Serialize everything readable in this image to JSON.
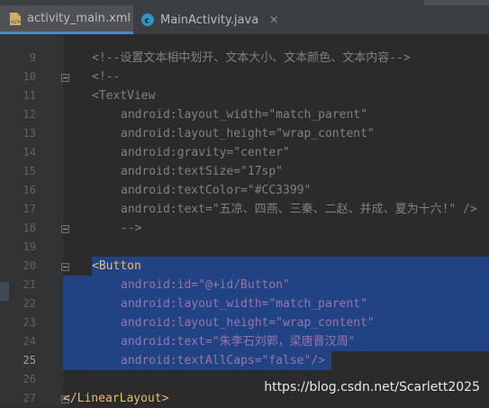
{
  "tabs": [
    {
      "label": "activity_main.xml",
      "icon": "xml-file-icon"
    },
    {
      "label": "MainActivity.java",
      "icon": "java-class-icon"
    }
  ],
  "lines": [
    {
      "num": "9",
      "text": "<!--设置文本相中划开、文本大小、文本颜色、文本内容-->"
    },
    {
      "num": "10",
      "text": "<!--"
    },
    {
      "num": "11",
      "text": "<TextView"
    },
    {
      "num": "12",
      "text": "android:layout_width=\"match_parent\""
    },
    {
      "num": "13",
      "text": "android:layout_height=\"wrap_content\""
    },
    {
      "num": "14",
      "text": "android:gravity=\"center\""
    },
    {
      "num": "15",
      "text": "android:textSize=\"17sp\""
    },
    {
      "num": "16",
      "text": "android:textColor=\"#CC3399\""
    },
    {
      "num": "17",
      "text": "android:text=\"五凉、四燕、三秦、二赵、并成、夏为十六!\" />"
    },
    {
      "num": "18",
      "text": "-->"
    },
    {
      "num": "19",
      "text": ""
    },
    {
      "num": "20",
      "text": "<Button"
    },
    {
      "num": "21",
      "text": "android:id=\"@+id/Button\""
    },
    {
      "num": "22",
      "text": "android:layout_width=\"match_parent\""
    },
    {
      "num": "23",
      "text": "android:layout_height=\"wrap_content\""
    },
    {
      "num": "24",
      "text": "android:text=\"朱李石刘郭，梁唐晋汉周\""
    },
    {
      "num": "25",
      "text": "android:textAllCaps=\"false\"/>"
    },
    {
      "num": "26",
      "text": ""
    },
    {
      "num": "27",
      "text": "</LinearLayout>"
    }
  ],
  "watermark": "https://blog.csdn.net/Scarlett2025"
}
